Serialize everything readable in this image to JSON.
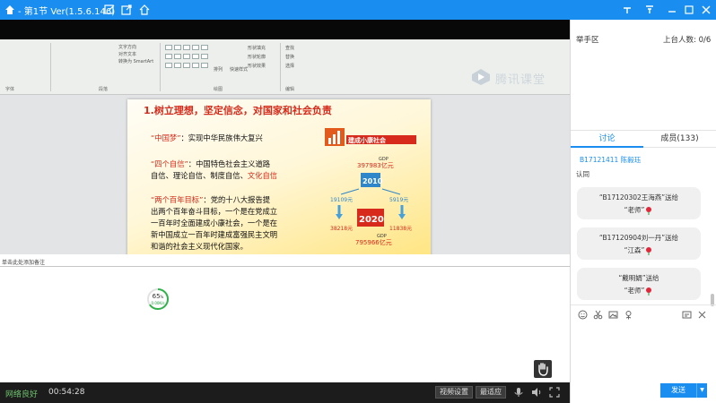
{
  "window": {
    "title": "- 第1节 Ver(1.5.6.146)",
    "controls": {
      "pin": "pin-icon",
      "minimize": "minimize-icon",
      "maximize": "maximize-icon",
      "close": "close-icon"
    }
  },
  "ribbon": {
    "groups": [
      "字体",
      "段落",
      "绘图"
    ],
    "labels": [
      "文字方向",
      "对齐文本",
      "转换为 SmartArt",
      "排列",
      "快速样式",
      "形状填充",
      "形状轮廓",
      "形状效果",
      "查找",
      "替换",
      "选择",
      "编辑"
    ]
  },
  "brand": {
    "name": "腾讯课堂"
  },
  "slide": {
    "title": "1.树立理想，坚定信念，对国家和社会负责",
    "p1": {
      "highlight": "“中国梦”",
      "rest": "：实现中华民族伟大复兴"
    },
    "p2": {
      "highlight": "“四个自信”",
      "rest1": "：中国特色社会主义道路",
      "rest2": "自信、理论自信、制度自信、",
      "highlight2": "文化自信"
    },
    "p3": {
      "highlight": "“两个百年目标”",
      "rest1": "：党的十八大报告提",
      "line2": "出两个百年奋斗目标，一个是在党成立",
      "line3": "一百年时全面建成小康社会，一个是在",
      "line4": "新中国成立一百年时建成富强民主文明",
      "line5": "和谐的社会主义现代化国家。"
    },
    "infographic": {
      "banner": "建成小康社会",
      "gdp1_label": "GDP",
      "gdp1_value": "397983亿元",
      "year1": "2010",
      "left1": "19109元",
      "right1": "5919元",
      "year2": "2020",
      "left2": "38218元",
      "right2": "11838元",
      "gdp2_label": "GDP",
      "gdp2_value": "795966亿元"
    }
  },
  "notes": {
    "placeholder": "单击此处添加备注"
  },
  "network": {
    "value": "65",
    "unit": "%",
    "sub": "0.00K/s"
  },
  "statusbar": {
    "network_label": "网络良好",
    "elapsed": "00:54:28",
    "video_settings": "视频设置",
    "fit": "最适应"
  },
  "side": {
    "hand_raise": "举手区",
    "stage_count": "上台人数: 0/6",
    "tab_discussion": "讨论",
    "tab_members": "成员(133)",
    "messages": [
      {
        "user": "B17121411 陈毅珏",
        "text": "认同"
      }
    ],
    "gifts": [
      {
        "line1": "“B17120302王海燕”送给",
        "line2": "“老师”"
      },
      {
        "line1": "“B17120904刘一丹”送给",
        "line2": "“江森”"
      },
      {
        "line1": "“戴明娟”送给",
        "line2": "“老师”"
      }
    ],
    "send": "发送"
  }
}
